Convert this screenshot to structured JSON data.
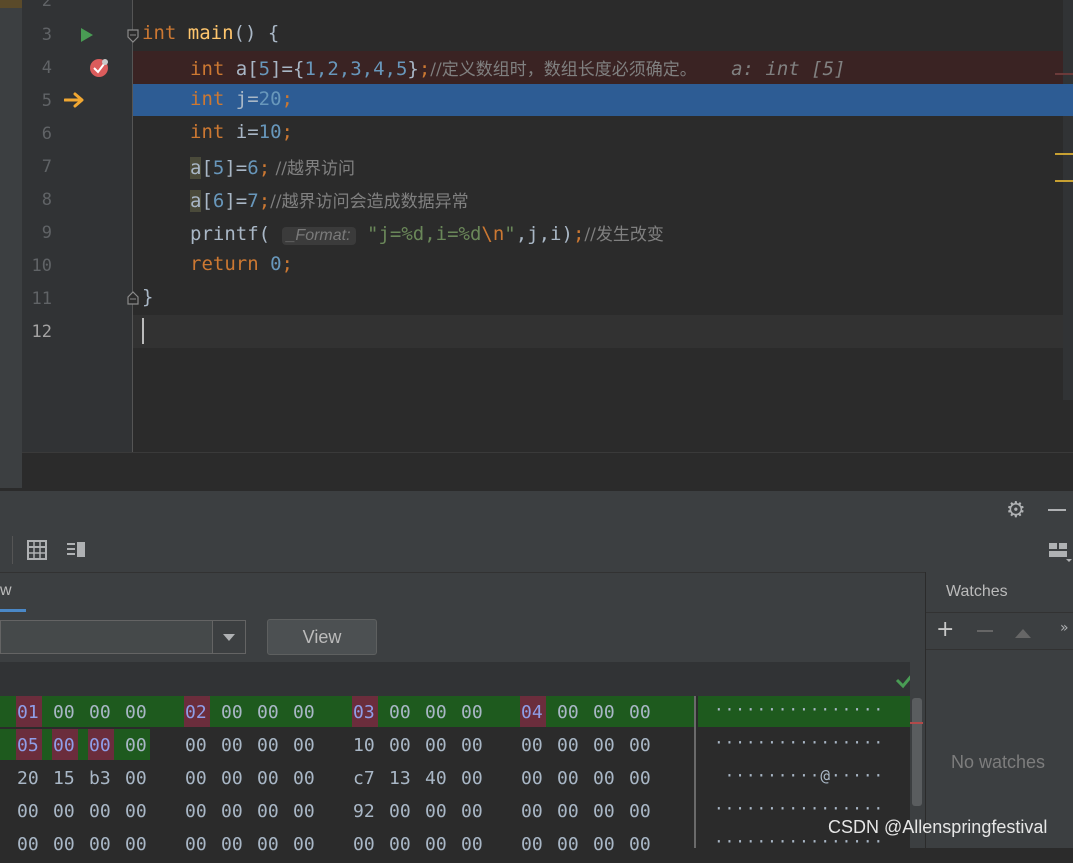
{
  "editor": {
    "line_numbers": [
      "2",
      "3",
      "4",
      "5",
      "6",
      "7",
      "8",
      "9",
      "10",
      "11",
      "12"
    ],
    "lines": {
      "l3": {
        "kw": "int",
        "fn": "main",
        "rest": "() {"
      },
      "l4": {
        "kw": "int",
        "var": " a[",
        "n5": "5",
        "mid": "]={",
        "nums": "1,2,3,4,5",
        "close": "}",
        "semi": ";",
        "comment": "//定义数组时，数组长度必须确定。",
        "hint": "a: int [5]"
      },
      "l5": {
        "kw": "int",
        "var": " j=",
        "val": "20",
        "semi": ";"
      },
      "l6": {
        "kw": "int",
        "var": " i=",
        "val": "10",
        "semi": ";"
      },
      "l7": {
        "a": "a",
        "mid": "[",
        "idx": "5",
        "end": "]=",
        "val": "6",
        "semi": ";",
        "comment": " //越界访问"
      },
      "l8": {
        "a": "a",
        "mid": "[",
        "idx": "6",
        "end": "]=",
        "val": "7",
        "semi": ";",
        "comment": "//越界访问会造成数据异常"
      },
      "l9": {
        "fn": "printf(",
        "param": "_Format:",
        "str": "\"j=%d,i=%d",
        "esc": "\\n",
        "strend": "\"",
        "rest": ",j,i)",
        "semi": ";",
        "comment": "//发生改变"
      },
      "l10": {
        "kw": "return",
        "val": "0",
        "semi": ";"
      },
      "l11": {
        "rest": "}"
      }
    }
  },
  "memory_view": {
    "tab_label": "w",
    "view_button": "View",
    "rows": [
      {
        "cells": [
          "01",
          "00",
          "00",
          "00",
          "02",
          "00",
          "00",
          "00",
          "03",
          "00",
          "00",
          "00",
          "04",
          "00",
          "00",
          "00"
        ],
        "ascii": "················"
      },
      {
        "cells": [
          "05",
          "00",
          "00",
          "00",
          "00",
          "00",
          "00",
          "00",
          "10",
          "00",
          "00",
          "00",
          "00",
          "00",
          "00",
          "00"
        ],
        "ascii": "················"
      },
      {
        "cells": [
          "20",
          "15",
          "b3",
          "00",
          "00",
          "00",
          "00",
          "00",
          "c7",
          "13",
          "40",
          "00",
          "00",
          "00",
          "00",
          "00"
        ],
        "ascii": " ·········@·····"
      },
      {
        "cells": [
          "00",
          "00",
          "00",
          "00",
          "00",
          "00",
          "00",
          "00",
          "92",
          "00",
          "00",
          "00",
          "00",
          "00",
          "00",
          "00"
        ],
        "ascii": "················"
      },
      {
        "cells": [
          "00",
          "00",
          "00",
          "00",
          "00",
          "00",
          "00",
          "00",
          "00",
          "00",
          "00",
          "00",
          "00",
          "00",
          "00",
          "00"
        ],
        "ascii": "················"
      }
    ]
  },
  "watches": {
    "title": "Watches",
    "empty_text": "No watches"
  },
  "watermark": "CSDN @Allenspringfestival",
  "colors": {
    "exec_line": "#2d5c94",
    "breakpoint_line": "#3a2323",
    "changed_bytes": "#1b5e20",
    "byte_highlight": "#7b2c3a"
  }
}
